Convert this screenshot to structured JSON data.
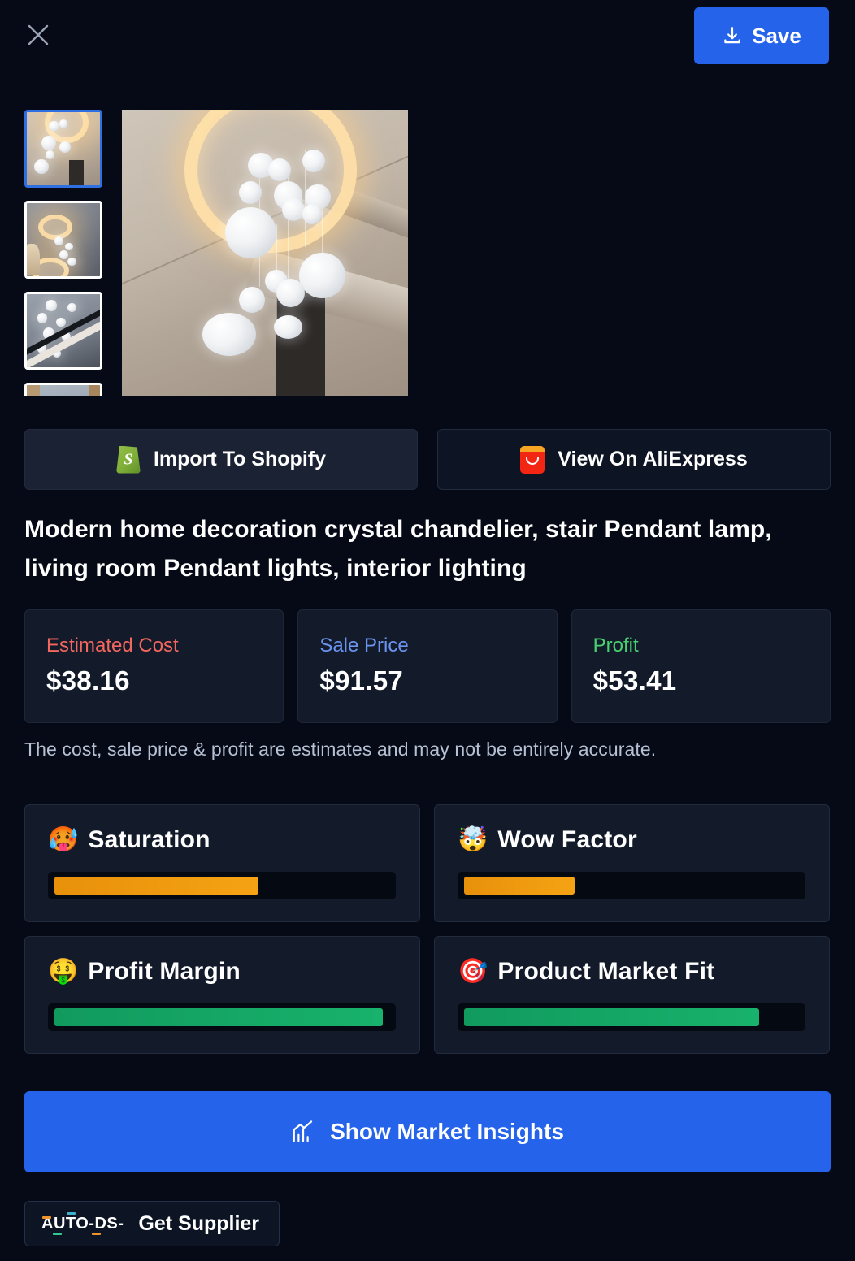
{
  "header": {
    "close_label": "Close",
    "close_icon": "close-icon",
    "save_label": "Save",
    "save_icon": "download-icon"
  },
  "gallery": {
    "thumbnails": [
      {
        "alt": "Chandelier with glowing ring and white orbs",
        "selected": true
      },
      {
        "alt": "Ceiling view of ring lights and orbs",
        "selected": false
      },
      {
        "alt": "Stairwell with hanging orb lights",
        "selected": false
      },
      {
        "alt": "Interior room with pendant lighting",
        "selected": false
      }
    ],
    "main_alt": "Modern bubble chandelier hanging from lit ceiling ring"
  },
  "actions": {
    "shopify_label": "Import To Shopify",
    "shopify_icon": "shopify-icon",
    "aliexpress_label": "View On AliExpress",
    "aliexpress_icon": "aliexpress-icon"
  },
  "product": {
    "title": "Modern home decoration crystal chandelier, stair Pendant lamp, living room Pendant lights, interior lighting"
  },
  "pricing": {
    "cards": [
      {
        "label": "Estimated Cost",
        "value": "$38.16",
        "color": "#f4675f"
      },
      {
        "label": "Sale Price",
        "value": "$91.57",
        "color": "#6b93f0"
      },
      {
        "label": "Profit",
        "value": "$53.41",
        "color": "#48d16f"
      }
    ],
    "disclaimer": "The cost, sale price & profit are estimates and may not be entirely accurate."
  },
  "metrics": [
    {
      "name": "Saturation",
      "emoji": "🥵",
      "percent": 61,
      "color": "#f5a314",
      "level": "warn"
    },
    {
      "name": "Wow Factor",
      "emoji": "🤯",
      "percent": 33,
      "color": "#f5a314",
      "level": "warn"
    },
    {
      "name": "Profit Margin",
      "emoji": "🤑",
      "percent": 98,
      "color": "#18b26c",
      "level": "good"
    },
    {
      "name": "Product Market Fit",
      "emoji": "🎯",
      "percent": 88,
      "color": "#18b26c",
      "level": "good"
    }
  ],
  "footer": {
    "insights_label": "Show Market Insights",
    "insights_icon": "bar-chart-icon",
    "supplier_label": "Get Supplier",
    "supplier_brand": "AUTO-DS-"
  },
  "colors": {
    "background": "#060a16",
    "card": "#131b2b",
    "accent_blue": "#2563eb",
    "warn": "#f5a314",
    "good": "#18b26c"
  }
}
